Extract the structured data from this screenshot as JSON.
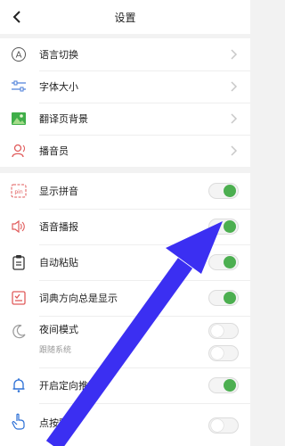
{
  "header": {
    "title": "设置",
    "back_icon": "chevron-left-icon"
  },
  "group1": {
    "items": [
      {
        "label": "语言切换",
        "icon": "language-a-icon"
      },
      {
        "label": "字体大小",
        "icon": "sliders-icon"
      },
      {
        "label": "翻译页背景",
        "icon": "image-icon"
      },
      {
        "label": "播音员",
        "icon": "announcer-icon"
      }
    ]
  },
  "group2": {
    "items": [
      {
        "label": "显示拼音",
        "icon": "pinyin-icon",
        "toggle": "on"
      },
      {
        "label": "语音播报",
        "icon": "speaker-icon",
        "toggle": "on"
      },
      {
        "label": "自动粘贴",
        "icon": "clipboard-icon",
        "toggle": "on"
      },
      {
        "label": "词典方向总是显示",
        "icon": "dictionary-icon",
        "toggle": "on"
      },
      {
        "label": "夜间模式",
        "sublabel": "跟随系统",
        "icon": "night-mode-icon",
        "toggle": "off",
        "sub_toggle": "off"
      },
      {
        "label": "开启定向推送",
        "icon": "bell-icon",
        "toggle": "on"
      },
      {
        "label": "点按翻",
        "icon": "tap-hand-icon",
        "toggle": "off"
      }
    ]
  },
  "colors": {
    "toggle_on": "#4caf50",
    "arrow": "#3b2ff2",
    "chevron": "#c8c8c8"
  }
}
